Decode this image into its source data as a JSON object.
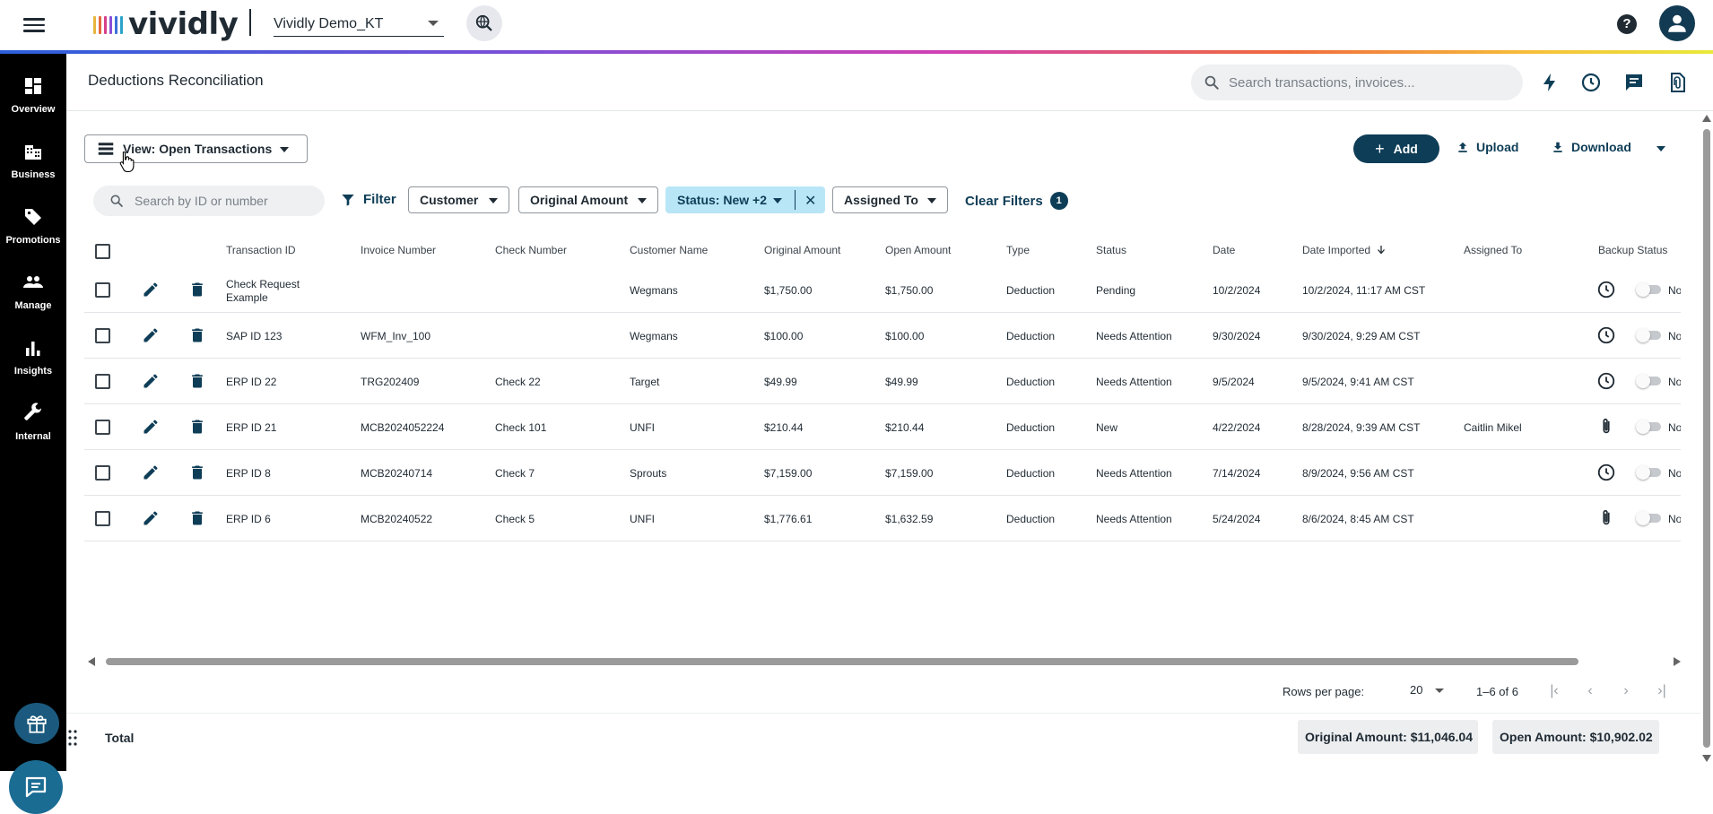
{
  "app": {
    "logo_text": "vividly",
    "logo_colors": [
      "#e9b53c",
      "#e5683c",
      "#d63f8a",
      "#8a4fd8",
      "#3a6fd9",
      "#2aa3c9"
    ],
    "org_name": "Vividly Demo_KT",
    "help_label": "?"
  },
  "sidebar": {
    "items": [
      {
        "label": "Overview",
        "icon": "dashboard-icon"
      },
      {
        "label": "Business",
        "icon": "building-icon"
      },
      {
        "label": "Promotions",
        "icon": "tag-icon"
      },
      {
        "label": "Manage",
        "icon": "people-icon"
      },
      {
        "label": "Insights",
        "icon": "bar-chart-icon"
      },
      {
        "label": "Internal",
        "icon": "wrench-icon"
      }
    ]
  },
  "header": {
    "title": "Deductions Reconciliation",
    "search_placeholder": "Search transactions, invoices..."
  },
  "toolbar": {
    "view_label": "View: Open Transactions",
    "add_label": "Add",
    "upload_label": "Upload",
    "download_label": "Download"
  },
  "filters": {
    "id_search_placeholder": "Search by ID or number",
    "filter_label": "Filter",
    "chips": [
      "Customer",
      "Original Amount",
      "Status: New +2",
      "Assigned To"
    ],
    "clear_label": "Clear Filters",
    "clear_count": "1"
  },
  "table": {
    "columns": [
      "Transaction ID",
      "Invoice Number",
      "Check Number",
      "Customer Name",
      "Original Amount",
      "Open Amount",
      "Type",
      "Status",
      "Date",
      "Date Imported",
      "Assigned To",
      "Backup Status"
    ],
    "rows": [
      {
        "transaction_id": "Check Request Example",
        "invoice": "",
        "check": "",
        "customer": "Wegmans",
        "original": "$1,750.00",
        "open": "$1,750.00",
        "type": "Deduction",
        "status": "Pending",
        "date": "10/2/2024",
        "imported": "10/2/2024, 11:17 AM CST",
        "assigned": "",
        "backup": "clock",
        "toggle_label": "No"
      },
      {
        "transaction_id": "SAP ID 123",
        "invoice": "WFM_Inv_100",
        "check": "",
        "customer": "Wegmans",
        "original": "$100.00",
        "open": "$100.00",
        "type": "Deduction",
        "status": "Needs Attention",
        "date": "9/30/2024",
        "imported": "9/30/2024, 9:29 AM CST",
        "assigned": "",
        "backup": "clock",
        "toggle_label": "No"
      },
      {
        "transaction_id": "ERP ID 22",
        "invoice": "TRG202409",
        "check": "Check 22",
        "customer": "Target",
        "original": "$49.99",
        "open": "$49.99",
        "type": "Deduction",
        "status": "Needs Attention",
        "date": "9/5/2024",
        "imported": "9/5/2024, 9:41 AM CST",
        "assigned": "",
        "backup": "clock",
        "toggle_label": "No"
      },
      {
        "transaction_id": "ERP ID 21",
        "invoice": "MCB2024052224",
        "check": "Check 101",
        "customer": "UNFI",
        "original": "$210.44",
        "open": "$210.44",
        "type": "Deduction",
        "status": "New",
        "date": "4/22/2024",
        "imported": "8/28/2024, 9:39 AM CST",
        "assigned": "Caitlin Mikel",
        "backup": "paperclip",
        "toggle_label": "No"
      },
      {
        "transaction_id": "ERP ID 8",
        "invoice": "MCB20240714",
        "check": "Check 7",
        "customer": "Sprouts",
        "original": "$7,159.00",
        "open": "$7,159.00",
        "type": "Deduction",
        "status": "Needs Attention",
        "date": "7/14/2024",
        "imported": "8/9/2024, 9:56 AM CST",
        "assigned": "",
        "backup": "clock",
        "toggle_label": "No"
      },
      {
        "transaction_id": "ERP ID 6",
        "invoice": "MCB20240522",
        "check": "Check 5",
        "customer": "UNFI",
        "original": "$1,776.61",
        "open": "$1,632.59",
        "type": "Deduction",
        "status": "Needs Attention",
        "date": "5/24/2024",
        "imported": "8/6/2024, 8:45 AM CST",
        "assigned": "",
        "backup": "paperclip",
        "toggle_label": "No"
      }
    ]
  },
  "pagination": {
    "rows_per_page_label": "Rows per page:",
    "rows_per_page": "20",
    "range": "1–6 of 6"
  },
  "totals": {
    "label": "Total",
    "original": "Original Amount: $11,046.04",
    "open": "Open Amount: $10,902.02"
  },
  "colors": {
    "primary": "#0e3d57",
    "active_chip": "#b8e6f6",
    "sidebar_bg": "#000000"
  }
}
